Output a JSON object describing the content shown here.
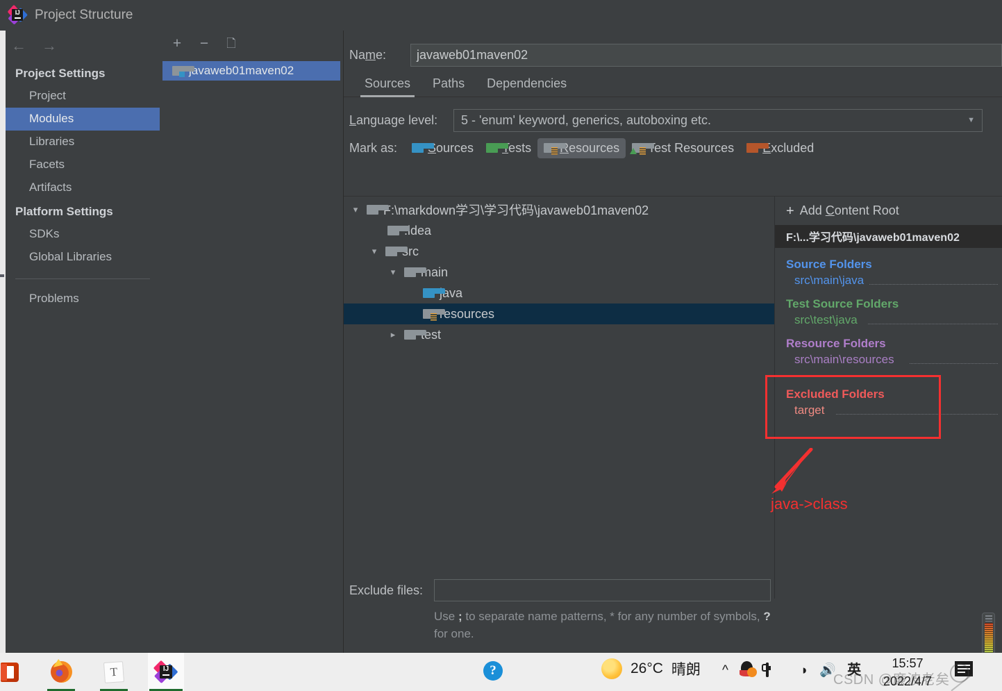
{
  "window": {
    "title": "Project Structure",
    "logo_icon": "intellij-idea-logo"
  },
  "nav": {
    "back_icon": "arrow-left-icon",
    "forward_icon": "arrow-right-icon"
  },
  "sidebar": {
    "groups": [
      {
        "label": "Project Settings",
        "items": [
          {
            "label": "Project",
            "selected": false
          },
          {
            "label": "Modules",
            "selected": true
          },
          {
            "label": "Libraries",
            "selected": false
          },
          {
            "label": "Facets",
            "selected": false
          },
          {
            "label": "Artifacts",
            "selected": false
          }
        ]
      },
      {
        "label": "Platform Settings",
        "items": [
          {
            "label": "SDKs",
            "selected": false
          },
          {
            "label": "Global Libraries",
            "selected": false
          }
        ]
      }
    ],
    "footer_item": "Problems",
    "selected_color": "#4b6eaf"
  },
  "modules_panel": {
    "toolbar": {
      "add_icon": "plus-icon",
      "remove_icon": "minus-icon",
      "copy_icon": "copy-icon"
    },
    "items": [
      {
        "label": "javaweb01maven02",
        "selected": true,
        "icon": "module-folder-icon"
      }
    ]
  },
  "main": {
    "name_label_pre": "Na",
    "name_label_accel": "m",
    "name_label_post": "e:",
    "name_value": "javaweb01maven02",
    "tabs": [
      {
        "label": "Sources",
        "active": true
      },
      {
        "label": "Paths",
        "active": false
      },
      {
        "label": "Dependencies",
        "active": false
      }
    ],
    "language_level": {
      "label_accel": "L",
      "label_rest": "anguage level:",
      "value": "5 - 'enum' keyword, generics, autoboxing etc.",
      "caret_icon": "chevron-down-icon"
    },
    "mark_as": {
      "label": "Mark as:",
      "options": [
        {
          "accel": "S",
          "rest": "ources",
          "icon": "folder-sources-icon",
          "color": "#3592c4",
          "pressed": false
        },
        {
          "accel": "T",
          "rest": "ests",
          "icon": "folder-tests-icon",
          "color": "#499c54",
          "pressed": false
        },
        {
          "accel": "R",
          "rest": "esources",
          "icon": "folder-resources-icon",
          "color": "#8d9499",
          "pressed": true
        },
        {
          "accel": "",
          "rest": "Test Resources",
          "icon": "folder-test-resources-icon",
          "color": "#8d9499",
          "pressed": false
        },
        {
          "accel": "E",
          "rest": "xcluded",
          "icon": "folder-excluded-icon",
          "color": "#b5562b",
          "pressed": false
        }
      ]
    },
    "exclude": {
      "label": "Exclude files:",
      "value": "",
      "hint_a": "Use ",
      "hint_semi": ";",
      "hint_b": " to separate name patterns, * for any number of symbols, ",
      "hint_q": "?",
      "hint_c": " for one."
    }
  },
  "tree": {
    "nodes": [
      {
        "label": "F:\\markdown学习\\学习代码\\javaweb01maven02",
        "indent": 0,
        "twist": "expanded",
        "icon": "folder-icon",
        "variant": "plain",
        "selected": false
      },
      {
        "label": ".idea",
        "indent": 1,
        "twist": "none",
        "icon": "folder-icon",
        "variant": "plain",
        "selected": false
      },
      {
        "label": "src",
        "indent": 1,
        "twist": "expanded",
        "icon": "folder-icon",
        "variant": "plain",
        "selected": false
      },
      {
        "label": "main",
        "indent": 2,
        "twist": "expanded",
        "icon": "folder-icon",
        "variant": "plain",
        "selected": false
      },
      {
        "label": "java",
        "indent": 3,
        "twist": "none",
        "icon": "folder-sources-icon",
        "variant": "blue",
        "selected": false
      },
      {
        "label": "resources",
        "indent": 3,
        "twist": "none",
        "icon": "folder-resources-icon",
        "variant": "resources",
        "selected": true
      },
      {
        "label": "test",
        "indent": 2,
        "twist": "collapsed",
        "icon": "folder-icon",
        "variant": "plain",
        "selected": false
      }
    ],
    "selected_bg": "#0d2d44"
  },
  "aside": {
    "add_content_root": {
      "plus_icon": "plus-icon",
      "label_a": "Add ",
      "label_accel": "C",
      "label_b": "ontent Root"
    },
    "root_path": "F:\\...学习代码\\javaweb01maven02",
    "groups": [
      {
        "title": "Source Folders",
        "title_color": "#5394ec",
        "item": "src\\main\\java",
        "item_color": "#5394ec"
      },
      {
        "title": "Test Source Folders",
        "title_color": "#62a86a",
        "item": "src\\test\\java",
        "item_color": "#62a86a"
      },
      {
        "title": "Resource Folders",
        "title_color": "#b07ecb",
        "item": "src\\main\\resources",
        "item_color": "#a97fc4"
      },
      {
        "title": "Excluded Folders",
        "title_color": "#f05a5a",
        "item": "target",
        "item_color": "#ef8a82"
      }
    ]
  },
  "annotation": {
    "box_color": "#f43030",
    "arrow_icon": "arrow-up-right-icon",
    "text": "java->class"
  },
  "inspection_widget": {
    "icon": "inspection-gradient-icon"
  },
  "taskbar": {
    "apps": [
      {
        "name": "office-icon",
        "label": "",
        "active": false,
        "running": false
      },
      {
        "name": "firefox-icon",
        "label": "",
        "active": false,
        "running": true
      },
      {
        "name": "typora-icon",
        "label": "T",
        "active": false,
        "running": true
      },
      {
        "name": "intellij-idea-icon",
        "label": "",
        "active": true,
        "running": true
      }
    ],
    "help_icon": "help-icon",
    "weather": {
      "icon": "sun-icon",
      "temperature": "26°C",
      "condition": "晴朗"
    },
    "tray": {
      "chevron_icon": "chevron-up-icon",
      "qq_icon": "qq-icon",
      "battery_icon": "battery-charging-icon",
      "wifi_icon": "wifi-icon",
      "volume_icon": "volume-icon",
      "ime_label": "英"
    },
    "clock": {
      "time": "15:57",
      "date": "2022/4/7"
    },
    "notification_icon": "notification-icon",
    "watermark": "CSDN @廉波老矣"
  }
}
